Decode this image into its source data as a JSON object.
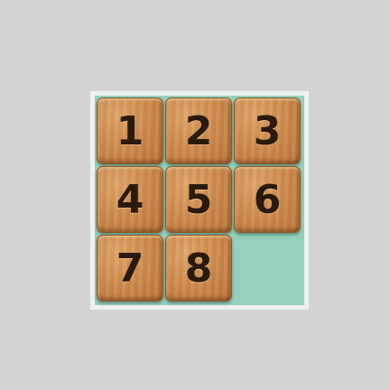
{
  "puzzle": {
    "tiles": [
      {
        "label": "1"
      },
      {
        "label": "2"
      },
      {
        "label": "3"
      },
      {
        "label": "4"
      },
      {
        "label": "5"
      },
      {
        "label": "6"
      },
      {
        "label": "7"
      },
      {
        "label": "8"
      }
    ],
    "colors": {
      "background": "#d4d4d4",
      "board_frame": "#eef0ef",
      "board": "#93d1bd",
      "tile_wood": "#cf8d50",
      "tile_text": "#2a1a0e"
    }
  }
}
